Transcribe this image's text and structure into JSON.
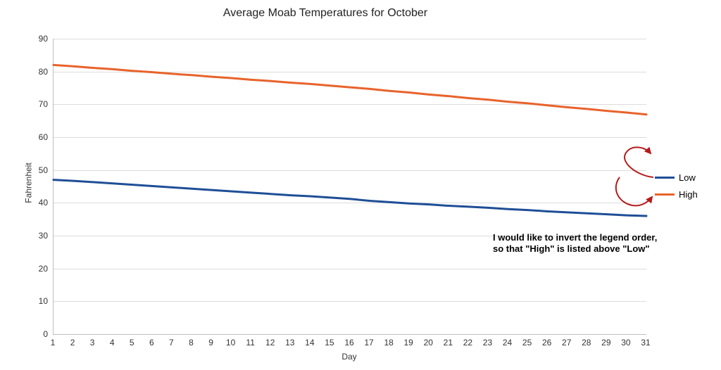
{
  "chart_data": {
    "type": "line",
    "title": "Average Moab Temperatures for October",
    "xlabel": "Day",
    "ylabel": "Fahrenheit",
    "x": [
      1,
      2,
      3,
      4,
      5,
      6,
      7,
      8,
      9,
      10,
      11,
      12,
      13,
      14,
      15,
      16,
      17,
      18,
      19,
      20,
      21,
      22,
      23,
      24,
      25,
      26,
      27,
      28,
      29,
      30,
      31
    ],
    "x_ticks": [
      1,
      2,
      3,
      4,
      5,
      6,
      7,
      8,
      9,
      10,
      11,
      12,
      13,
      14,
      15,
      16,
      17,
      18,
      19,
      20,
      21,
      22,
      23,
      24,
      25,
      26,
      27,
      28,
      29,
      30,
      31
    ],
    "y_ticks": [
      0,
      10,
      20,
      30,
      40,
      50,
      60,
      70,
      80,
      90
    ],
    "ylim": [
      0,
      90
    ],
    "xlim": [
      1,
      31
    ],
    "grid": {
      "y": true,
      "x": false
    },
    "series": [
      {
        "name": "Low",
        "color": "#1f4e96",
        "values": [
          47.0,
          46.7,
          46.3,
          45.9,
          45.5,
          45.1,
          44.7,
          44.3,
          43.9,
          43.5,
          43.1,
          42.7,
          42.3,
          42.0,
          41.6,
          41.2,
          40.6,
          40.2,
          39.8,
          39.5,
          39.1,
          38.8,
          38.5,
          38.1,
          37.8,
          37.4,
          37.1,
          36.8,
          36.5,
          36.2,
          36.0
        ]
      },
      {
        "name": "High",
        "color": "#e8632c",
        "values": [
          82.0,
          81.6,
          81.1,
          80.7,
          80.2,
          79.8,
          79.3,
          78.9,
          78.4,
          78.0,
          77.5,
          77.1,
          76.6,
          76.2,
          75.7,
          75.2,
          74.7,
          74.1,
          73.6,
          73.0,
          72.5,
          71.9,
          71.4,
          70.8,
          70.3,
          69.7,
          69.1,
          68.6,
          68.0,
          67.5,
          66.9
        ]
      }
    ],
    "legend": {
      "position": "right",
      "order": [
        "Low",
        "High"
      ]
    }
  },
  "annotation": {
    "line1": "I would like to invert the legend order,",
    "line2": "so that \"High\" is listed above \"Low\"",
    "arrow_color": "#b51a1a"
  }
}
